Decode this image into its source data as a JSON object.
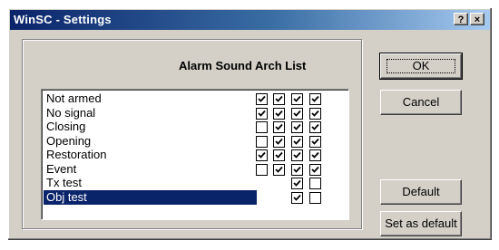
{
  "window": {
    "title": "WinSC - Settings",
    "help_glyph": "?",
    "close_glyph": "×"
  },
  "list": {
    "header": "Alarm Sound Arch List",
    "rows": [
      {
        "label": "Not armed",
        "checks": [
          true,
          true,
          true,
          true
        ],
        "selected": false
      },
      {
        "label": "No signal",
        "checks": [
          true,
          true,
          true,
          true
        ],
        "selected": false
      },
      {
        "label": "Closing",
        "checks": [
          false,
          true,
          true,
          true
        ],
        "selected": false
      },
      {
        "label": "Opening",
        "checks": [
          false,
          true,
          true,
          true
        ],
        "selected": false
      },
      {
        "label": "Restoration",
        "checks": [
          true,
          true,
          true,
          true
        ],
        "selected": false
      },
      {
        "label": "Event",
        "checks": [
          false,
          true,
          true,
          true
        ],
        "selected": false
      },
      {
        "label": "Tx test",
        "checks": [
          null,
          null,
          true,
          false
        ],
        "selected": false
      },
      {
        "label": "Obj test",
        "checks": [
          null,
          null,
          true,
          false
        ],
        "selected": true
      }
    ]
  },
  "buttons": {
    "ok": "OK",
    "cancel": "Cancel",
    "default": "Default",
    "set_as_default": "Set as default"
  },
  "colors": {
    "selection": "#0a246a",
    "face": "#d4d0c8"
  }
}
